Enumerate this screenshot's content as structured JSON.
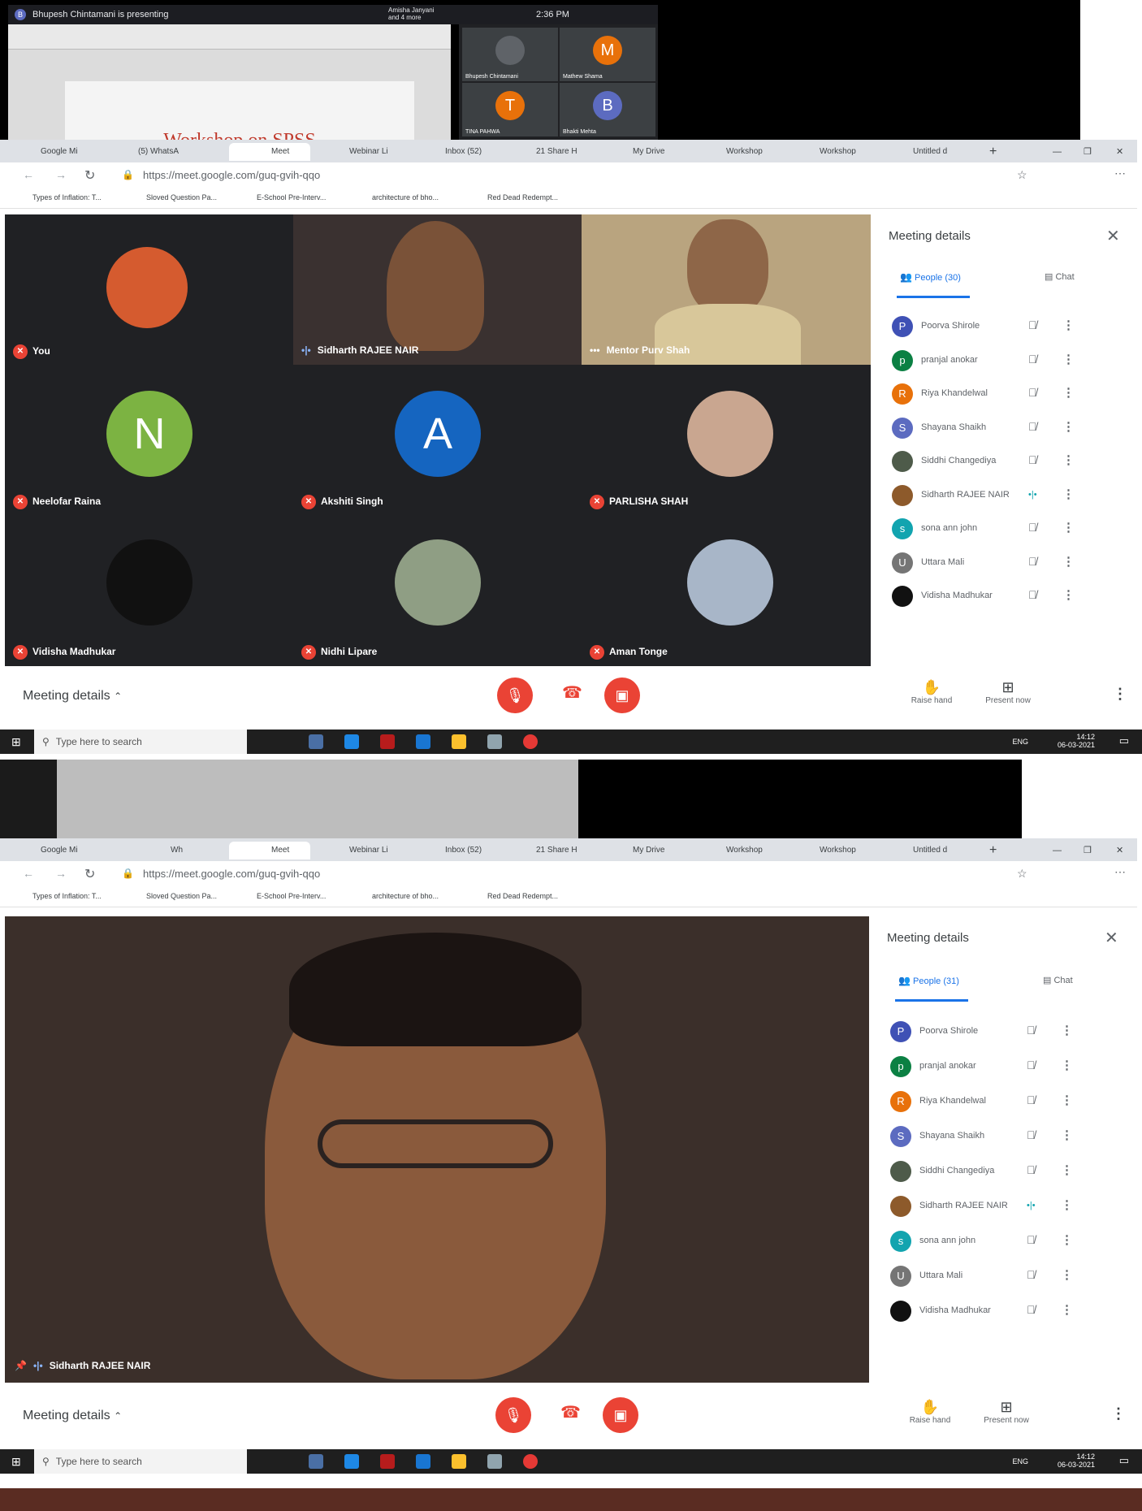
{
  "presentation": {
    "header": "Bhupesh Chintamani is presenting",
    "others": "Amisha Janyani and 4 more",
    "time": "2:36 PM",
    "slide_title": "Workshop on SPSS",
    "tiles": [
      {
        "name": "Bhupesh Chintamani",
        "initial": "",
        "color": "#5f6368"
      },
      {
        "name": "Mathew Shama",
        "initial": "M",
        "color": "#e8710a"
      },
      {
        "name": "TINA PAHWA",
        "initial": "T",
        "color": "#e8710a"
      },
      {
        "name": "Bhakti Mehta",
        "initial": "B",
        "color": "#5c6bc0"
      }
    ]
  },
  "browser": {
    "tabs": [
      "Google Mi",
      "(5) WhatsA",
      "Meet",
      "Webinar Li",
      "Inbox (52)",
      "21 Share H",
      "My Drive",
      "Workshop",
      "Workshop",
      "Untitled d"
    ],
    "tabs_second": [
      "Google Mi",
      "Wh",
      "Meet",
      "Webinar Li",
      "Inbox (52)",
      "21 Share H",
      "My Drive",
      "Workshop",
      "Workshop",
      "Untitled d"
    ],
    "url": "https://meet.google.com/guq-gvih-qqo",
    "bookmarks": [
      "Types of Inflation: T...",
      "Sloved Question Pa...",
      "E-School Pre-Interv...",
      "architecture of bho...",
      "Red Dead Redempt..."
    ]
  },
  "meet1": {
    "tiles": [
      {
        "name": "You",
        "muted": true
      },
      {
        "name": "Sidharth RAJEE NAIR",
        "muted": false
      },
      {
        "name": "Mentor Purv Shah",
        "muted": false
      },
      {
        "name": "Neelofar Raina",
        "muted": true,
        "initial": "N",
        "color": "#7cb342"
      },
      {
        "name": "Akshiti Singh",
        "muted": true,
        "initial": "A",
        "color": "#1565c0"
      },
      {
        "name": "PARLISHA SHAH",
        "muted": true
      },
      {
        "name": "Vidisha Madhukar",
        "muted": true
      },
      {
        "name": "Nidhi Lipare",
        "muted": true
      },
      {
        "name": "Aman Tonge",
        "muted": true
      }
    ]
  },
  "meet2": {
    "speaker": "Sidharth RAJEE NAIR"
  },
  "panel": {
    "title": "Meeting details",
    "people_tab_1": "People (30)",
    "people_tab_2": "People (31)",
    "chat_tab": "Chat",
    "people": [
      {
        "name": "Poorva Shirole",
        "initial": "P",
        "color": "#3f51b5",
        "speaking": false
      },
      {
        "name": "pranjal anokar",
        "initial": "p",
        "color": "#0b8043",
        "speaking": false
      },
      {
        "name": "Riya Khandelwal",
        "initial": "R",
        "color": "#e8710a",
        "speaking": false
      },
      {
        "name": "Shayana Shaikh",
        "initial": "S",
        "color": "#5c6bc0",
        "speaking": false
      },
      {
        "name": "Siddhi Changediya",
        "initial": "",
        "color": "#4e5b4a",
        "speaking": false
      },
      {
        "name": "Sidharth RAJEE NAIR",
        "initial": "",
        "color": "#8d5a2b",
        "speaking": true
      },
      {
        "name": "sona ann john",
        "initial": "s",
        "color": "#12a4af",
        "speaking": false
      },
      {
        "name": "Uttara Mali",
        "initial": "U",
        "color": "#757575",
        "speaking": false
      },
      {
        "name": "Vidisha Madhukar",
        "initial": "",
        "color": "#111111",
        "speaking": false
      }
    ]
  },
  "controls": {
    "meeting_details": "Meeting details",
    "raise_hand": "Raise hand",
    "present_now": "Present now"
  },
  "taskbar": {
    "search_placeholder": "Type here to search",
    "lang": "ENG",
    "time": "14:12",
    "date": "06-03-2021"
  },
  "colors": {
    "stage": "#202124",
    "danger": "#ea4335",
    "accent": "#1a73e8"
  }
}
